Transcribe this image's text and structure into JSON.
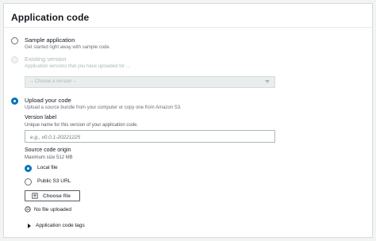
{
  "panel": {
    "title": "Application code"
  },
  "options": {
    "sample": {
      "label": "Sample application",
      "description": "Get started right away with sample code."
    },
    "existing": {
      "label": "Existing version",
      "description": "Application versions that you have uploaded for ..."
    },
    "upload": {
      "label": "Upload your code",
      "description": "Upload a source bundle from your computer or copy one from Amazon S3."
    }
  },
  "version_select": {
    "placeholder": "-- Choose a version --"
  },
  "version_label": {
    "label": "Version label",
    "description": "Unique name for this version of your application code.",
    "placeholder": "e.g., v0.0.1-20221225",
    "value": ""
  },
  "source_origin": {
    "label": "Source code origin",
    "description": "Maximum size 512 MB",
    "local_file": "Local file",
    "public_s3": "Public S3 URL"
  },
  "file": {
    "choose_label": "Choose file",
    "status": "No file uploaded"
  },
  "tags": {
    "label": "Application code tags"
  },
  "colors": {
    "accent": "#0073bb",
    "border": "#d5dbdb",
    "muted": "#687078"
  }
}
